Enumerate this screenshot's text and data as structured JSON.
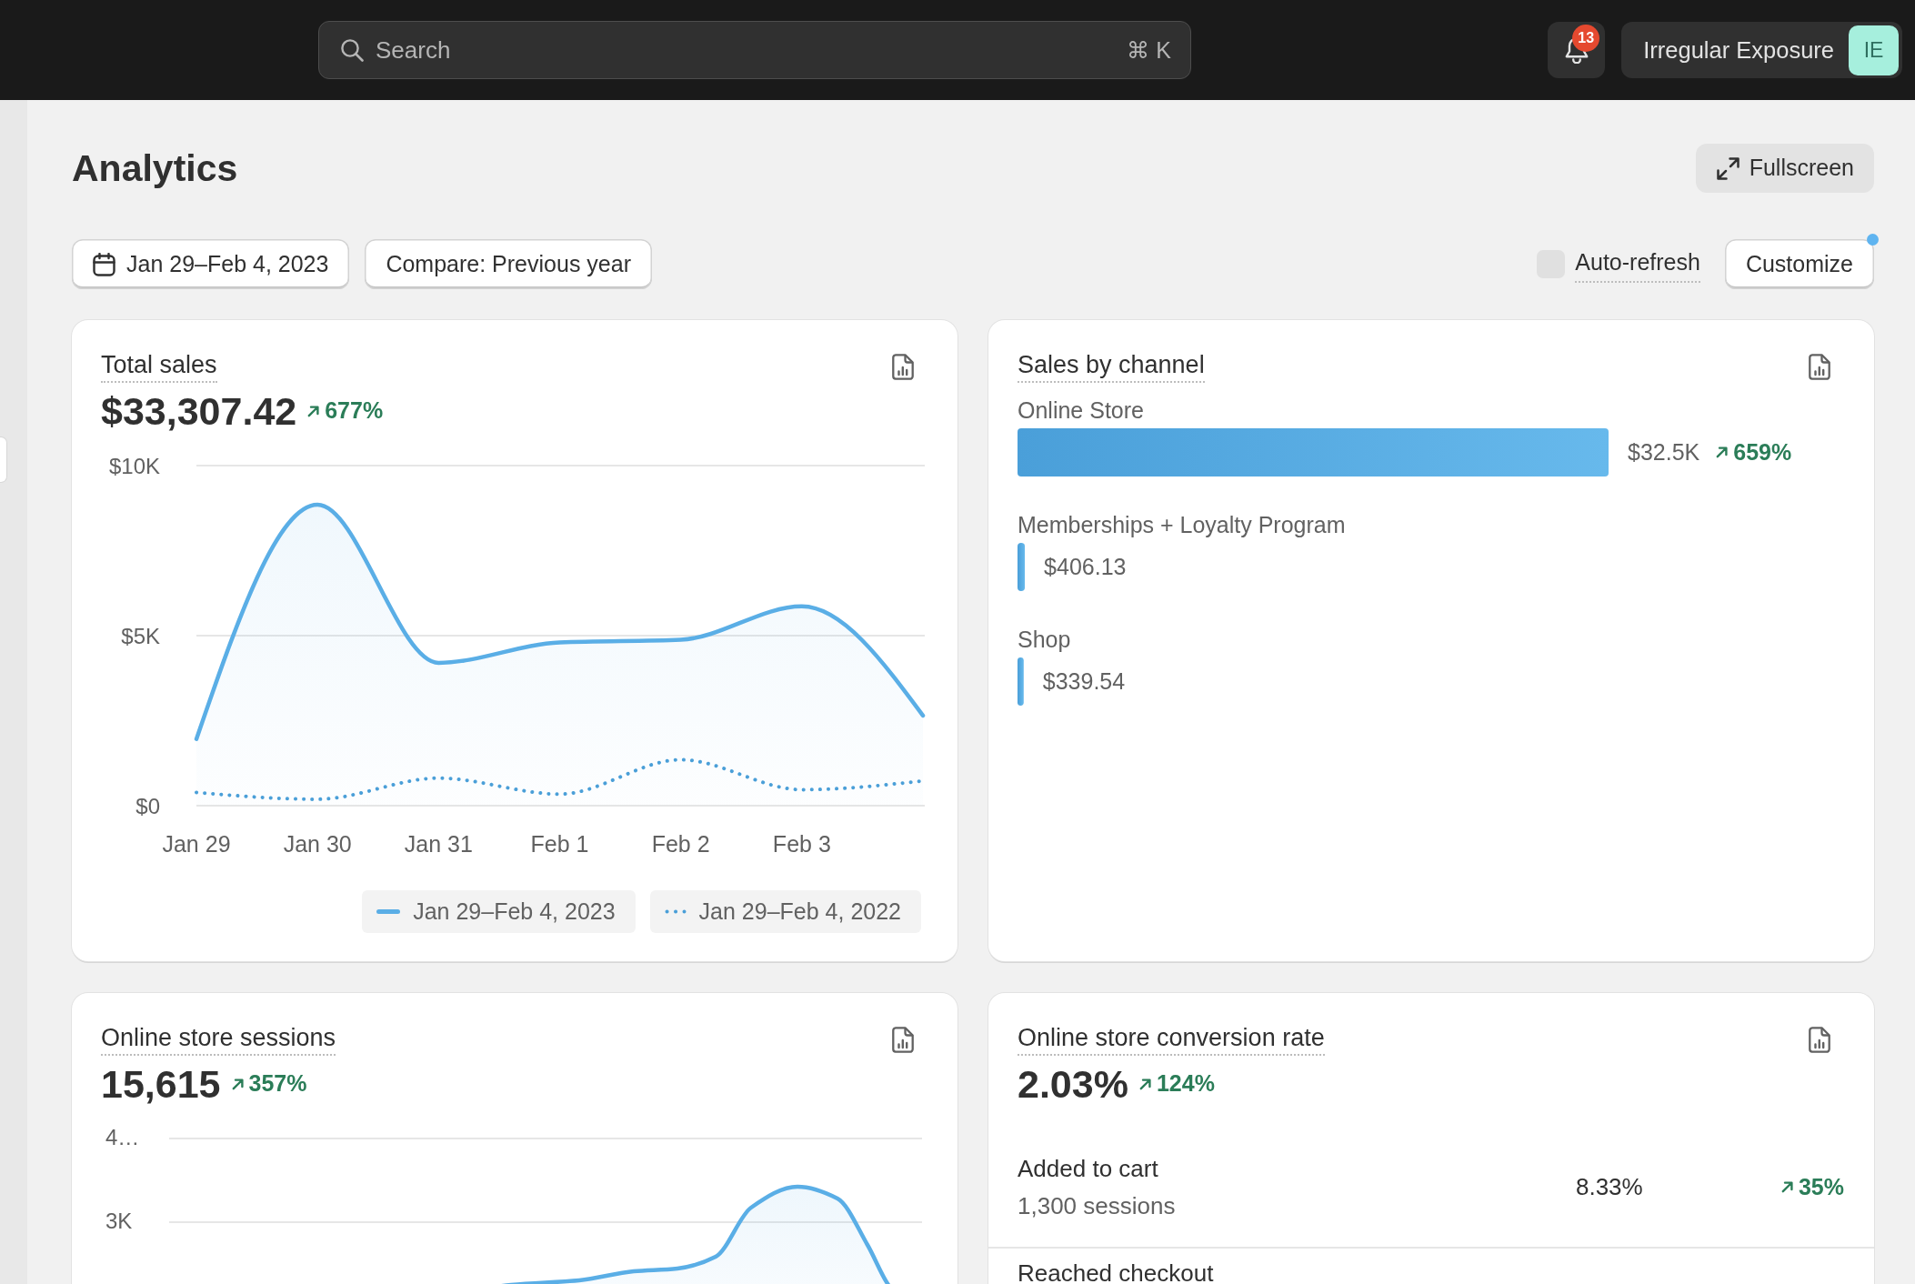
{
  "top_bar": {
    "search": {
      "placeholder": "Search",
      "shortcut": "⌘ K"
    },
    "notifications": {
      "count": "13"
    },
    "account": {
      "name": "Irregular Exposure",
      "initials": "IE"
    }
  },
  "header": {
    "title": "Analytics",
    "fullscreen_button": "Fullscreen"
  },
  "filters": {
    "date_range": "Jan 29–Feb 4, 2023",
    "compare": "Compare: Previous year",
    "auto_refresh": {
      "label": "Auto-refresh",
      "checked": false
    },
    "customize": {
      "label": "Customize",
      "indicator": true
    }
  },
  "cards": [
    {
      "kind": "line_chart",
      "title": "Total sales",
      "value": "$33,307.42",
      "change": "677%",
      "chart_data": {
        "type": "area",
        "categories": [
          "Jan 29",
          "Jan 30",
          "Jan 31",
          "Feb 1",
          "Feb 2",
          "Feb 3",
          null
        ],
        "ylim": [
          0,
          10000
        ],
        "yticks": [
          {
            "value": 0,
            "label": "$0"
          },
          {
            "value": 5000,
            "label": "$5K"
          },
          {
            "value": 10000,
            "label": "$10K"
          }
        ],
        "legend": true,
        "series": [
          {
            "name": "Jan 29–Feb 4, 2023",
            "color": "#5aaee6",
            "line_style": "solid",
            "values": [
              1960,
              8850,
              4200,
              4800,
              4880,
              5860,
              2650
            ]
          },
          {
            "name": "Jan 29–Feb 4, 2022",
            "color": "#4a9fd8",
            "type": "line",
            "line_style": "dotted",
            "values": [
              390,
              190,
              810,
              340,
              1350,
              470,
              730
            ]
          }
        ]
      }
    },
    {
      "kind": "channels",
      "title": "Sales by channel",
      "chart_data": {
        "type": "bar",
        "orientation": "horizontal",
        "categories": [
          "Online Store",
          "Memberships + Loyalty Program",
          "Shop"
        ],
        "values": [
          32500,
          406.13,
          339.54
        ],
        "value_labels": [
          "$32.5K",
          "$406.13",
          "$339.54"
        ],
        "annotations": [
          "659%"
        ]
      }
    },
    {
      "kind": "trend",
      "title": "Online store sessions",
      "value": "15,615",
      "change": "357%",
      "y_labels": [
        "4…",
        "3K"
      ]
    },
    {
      "kind": "funnel",
      "title": "Online store conversion rate",
      "value": "2.03%",
      "change": "124%",
      "steps": [
        {
          "label": "Added to cart",
          "sessions": "1,300 sessions",
          "rate": "8.33%",
          "change": "35%"
        },
        {
          "label": "Reached checkout"
        }
      ]
    }
  ]
}
